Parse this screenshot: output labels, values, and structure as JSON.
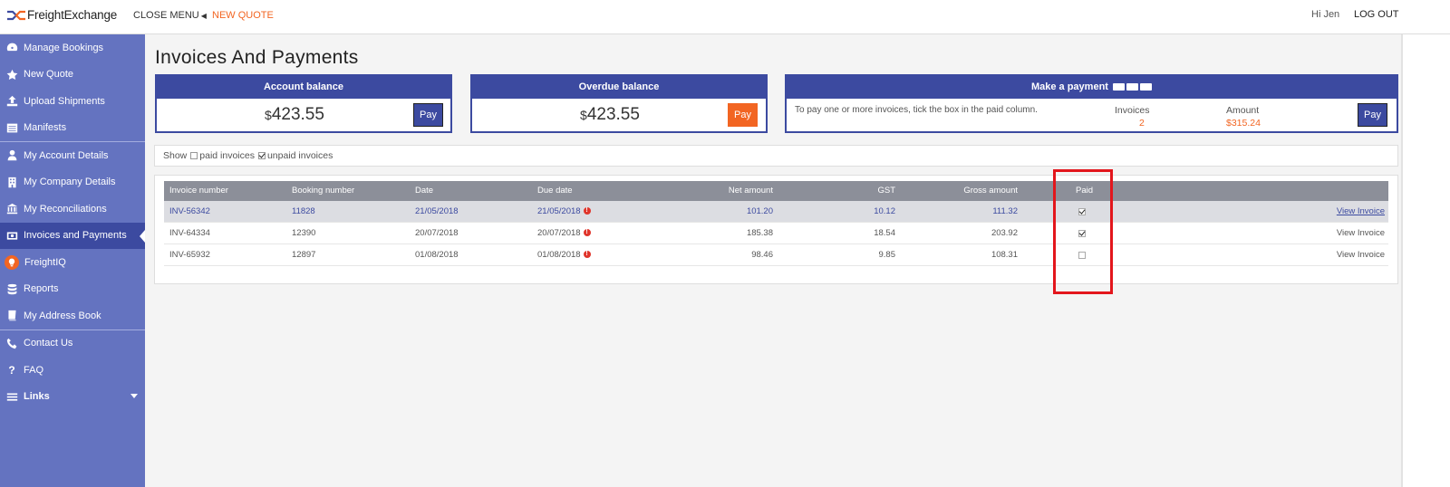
{
  "topbar": {
    "logo_text": "FreightExchange",
    "close_menu": "CLOSE MENU",
    "new_quote": "NEW QUOTE",
    "greeting": "Hi Jen",
    "logout": "LOG OUT",
    "accent": "#f26522"
  },
  "sidebar": {
    "bg": "#6473c0",
    "active_bg": "#3c4aa0",
    "items": [
      {
        "label": "Manage Bookings",
        "icon": "dashboard-icon"
      },
      {
        "label": "New Quote",
        "icon": "star-icon"
      },
      {
        "label": "Upload Shipments",
        "icon": "upload-icon"
      },
      {
        "label": "Manifests",
        "icon": "list-icon"
      },
      {
        "label": "My Account Details",
        "icon": "user-icon"
      },
      {
        "label": "My Company Details",
        "icon": "building-icon"
      },
      {
        "label": "My Reconciliations",
        "icon": "bank-icon"
      },
      {
        "label": "Invoices and Payments",
        "icon": "money-icon"
      },
      {
        "label": "FreightIQ",
        "icon": "lightbulb-icon"
      },
      {
        "label": "Reports",
        "icon": "database-icon"
      },
      {
        "label": "My Address Book",
        "icon": "book-icon"
      },
      {
        "label": "Contact Us",
        "icon": "phone-icon"
      },
      {
        "label": "FAQ",
        "icon": "question-icon"
      },
      {
        "label": "Links",
        "icon": "menu-icon"
      }
    ]
  },
  "page": {
    "title": "Invoices And Payments"
  },
  "cards": {
    "account": {
      "title": "Account balance",
      "currency": "$",
      "amount": "423.55",
      "button": "Pay"
    },
    "overdue": {
      "title": "Overdue balance",
      "currency": "$",
      "amount": "423.55",
      "button": "Pay"
    },
    "payment": {
      "title": "Make a payment",
      "note": "To pay one or more invoices, tick the box in the paid column.",
      "invoices_label": "Invoices",
      "invoices_value": "2",
      "amount_label": "Amount",
      "amount_value": "$315.24",
      "button": "Pay"
    }
  },
  "filter": {
    "show": "Show",
    "paid": "paid invoices",
    "unpaid": "unpaid invoices",
    "paid_checked": false,
    "unpaid_checked": true
  },
  "table": {
    "headers": [
      "Invoice number",
      "Booking number",
      "Date",
      "Due date",
      "Net amount",
      "GST",
      "Gross amount",
      "Paid"
    ],
    "view_label": "View Invoice",
    "rows": [
      {
        "invoice": "INV-56342",
        "booking": "11828",
        "date": "21/05/2018",
        "due": "21/05/2018",
        "net": "101.20",
        "gst": "10.12",
        "gross": "111.32",
        "paid": true
      },
      {
        "invoice": "INV-64334",
        "booking": "12390",
        "date": "20/07/2018",
        "due": "20/07/2018",
        "net": "185.38",
        "gst": "18.54",
        "gross": "203.92",
        "paid": true
      },
      {
        "invoice": "INV-65932",
        "booking": "12897",
        "date": "01/08/2018",
        "due": "01/08/2018",
        "net": "98.46",
        "gst": "9.85",
        "gross": "108.31",
        "paid": false
      }
    ]
  }
}
